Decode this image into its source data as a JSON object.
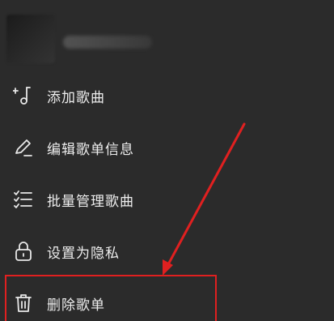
{
  "menu": {
    "items": [
      {
        "label": "添加歌曲",
        "icon": "add-music-icon"
      },
      {
        "label": "编辑歌单信息",
        "icon": "edit-pencil-icon"
      },
      {
        "label": "批量管理歌曲",
        "icon": "checklist-icon"
      },
      {
        "label": "设置为隐私",
        "icon": "lock-icon"
      },
      {
        "label": "删除歌单",
        "icon": "trash-icon"
      }
    ]
  },
  "annotation": {
    "color": "#e02020"
  }
}
